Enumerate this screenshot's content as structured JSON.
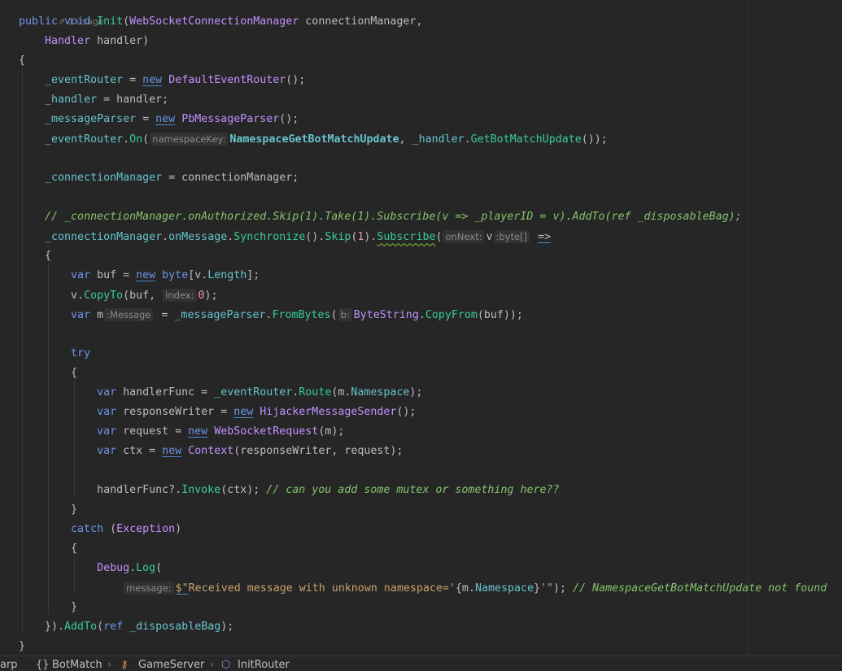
{
  "editor": {
    "usage_hint": "1 usage",
    "lines": [
      [
        [
          "kw",
          "public"
        ],
        [
          "txt",
          " "
        ],
        [
          "kw",
          "void"
        ],
        [
          "txt",
          " "
        ],
        [
          "fn",
          "Init"
        ],
        [
          "txt",
          "("
        ],
        [
          "type",
          "WebSocketConnectionManager"
        ],
        [
          "txt",
          " connectionManager,"
        ]
      ],
      [
        [
          "txt",
          "    "
        ],
        [
          "type",
          "Handler"
        ],
        [
          "txt",
          " handler)"
        ]
      ],
      [
        [
          "txt",
          "{"
        ]
      ],
      [
        [
          "txt",
          "    "
        ],
        [
          "field",
          "_eventRouter"
        ],
        [
          "txt",
          " = "
        ],
        [
          "kwu",
          "new"
        ],
        [
          "txt",
          " "
        ],
        [
          "type",
          "DefaultEventRouter"
        ],
        [
          "txt",
          "();"
        ]
      ],
      [
        [
          "txt",
          "    "
        ],
        [
          "field",
          "_handler"
        ],
        [
          "txt",
          " = handler;"
        ]
      ],
      [
        [
          "txt",
          "    "
        ],
        [
          "field",
          "_messageParser"
        ],
        [
          "txt",
          " = "
        ],
        [
          "kwu",
          "new"
        ],
        [
          "txt",
          " "
        ],
        [
          "type",
          "PbMessageParser"
        ],
        [
          "txt",
          "();"
        ]
      ],
      [
        [
          "txt",
          "    "
        ],
        [
          "field",
          "_eventRouter"
        ],
        [
          "txt",
          "."
        ],
        [
          "fn",
          "On"
        ],
        [
          "txt",
          "("
        ],
        [
          "hint",
          "namespaceKey:"
        ],
        [
          "const",
          "NamespaceGetBotMatchUpdate"
        ],
        [
          "txt",
          ", "
        ],
        [
          "field",
          "_handler"
        ],
        [
          "txt",
          "."
        ],
        [
          "fn",
          "GetBotMatchUpdate"
        ],
        [
          "txt",
          "());"
        ]
      ],
      [],
      [
        [
          "txt",
          "    "
        ],
        [
          "field",
          "_connectionManager"
        ],
        [
          "txt",
          " = connectionManager;"
        ]
      ],
      [],
      [
        [
          "txt",
          "    "
        ],
        [
          "cmt",
          "// _connectionManager.onAuthorized.Skip(1).Take(1).Subscribe(v => _playerID = v).AddTo(ref _disposableBag);"
        ]
      ],
      [
        [
          "txt",
          "    "
        ],
        [
          "field",
          "_connectionManager"
        ],
        [
          "txt",
          "."
        ],
        [
          "field",
          "onMessage"
        ],
        [
          "txt",
          "."
        ],
        [
          "fn",
          "Synchronize"
        ],
        [
          "txt",
          "()."
        ],
        [
          "fn",
          "Skip"
        ],
        [
          "txt",
          "("
        ],
        [
          "num",
          "1"
        ],
        [
          "txt",
          ")."
        ],
        [
          "fnw",
          "Subscribe"
        ],
        [
          "txt",
          "("
        ],
        [
          "hint",
          "onNext:"
        ],
        [
          "txt",
          "v"
        ],
        [
          "hint",
          ":byte[]"
        ],
        [
          "txt",
          " "
        ],
        [
          "txtu",
          "=>"
        ]
      ],
      [
        [
          "txt",
          "    {"
        ]
      ],
      [
        [
          "txt",
          "        "
        ],
        [
          "kw",
          "var"
        ],
        [
          "txt",
          " buf = "
        ],
        [
          "kwu",
          "new"
        ],
        [
          "txt",
          " "
        ],
        [
          "kw",
          "byte"
        ],
        [
          "txt",
          "[v."
        ],
        [
          "field",
          "Length"
        ],
        [
          "txt",
          "];"
        ]
      ],
      [
        [
          "txt",
          "        v."
        ],
        [
          "fn",
          "CopyTo"
        ],
        [
          "txt",
          "(buf, "
        ],
        [
          "hint",
          "index:"
        ],
        [
          "num",
          "0"
        ],
        [
          "txt",
          ");"
        ]
      ],
      [
        [
          "txt",
          "        "
        ],
        [
          "kw",
          "var"
        ],
        [
          "txt",
          " m"
        ],
        [
          "hint",
          ":Message"
        ],
        [
          "txt",
          " = "
        ],
        [
          "field",
          "_messageParser"
        ],
        [
          "txt",
          "."
        ],
        [
          "fn",
          "FromBytes"
        ],
        [
          "txt",
          "("
        ],
        [
          "hint",
          "b:"
        ],
        [
          "type",
          "ByteString"
        ],
        [
          "txt",
          "."
        ],
        [
          "fn",
          "CopyFrom"
        ],
        [
          "txt",
          "(buf));"
        ]
      ],
      [],
      [
        [
          "txt",
          "        "
        ],
        [
          "kw",
          "try"
        ]
      ],
      [
        [
          "txt",
          "        {"
        ]
      ],
      [
        [
          "txt",
          "            "
        ],
        [
          "kw",
          "var"
        ],
        [
          "txt",
          " handlerFunc = "
        ],
        [
          "field",
          "_eventRouter"
        ],
        [
          "txt",
          "."
        ],
        [
          "fn",
          "Route"
        ],
        [
          "txt",
          "(m."
        ],
        [
          "field",
          "Namespace"
        ],
        [
          "txt",
          ");"
        ]
      ],
      [
        [
          "txt",
          "            "
        ],
        [
          "kw",
          "var"
        ],
        [
          "txt",
          " responseWriter = "
        ],
        [
          "kwu",
          "new"
        ],
        [
          "txt",
          " "
        ],
        [
          "type",
          "HijackerMessageSender"
        ],
        [
          "txt",
          "();"
        ]
      ],
      [
        [
          "txt",
          "            "
        ],
        [
          "kw",
          "var"
        ],
        [
          "txt",
          " request = "
        ],
        [
          "kwu",
          "new"
        ],
        [
          "txt",
          " "
        ],
        [
          "type",
          "WebSocketRequest"
        ],
        [
          "txt",
          "(m);"
        ]
      ],
      [
        [
          "txt",
          "            "
        ],
        [
          "kw",
          "var"
        ],
        [
          "txt",
          " ctx = "
        ],
        [
          "kwu",
          "new"
        ],
        [
          "txt",
          " "
        ],
        [
          "type",
          "Context"
        ],
        [
          "txt",
          "(responseWriter, request);"
        ]
      ],
      [],
      [
        [
          "txt",
          "            handlerFunc?."
        ],
        [
          "fn",
          "Invoke"
        ],
        [
          "txt",
          "(ctx); "
        ],
        [
          "cmt",
          "// can you add some mutex or something here??"
        ]
      ],
      [
        [
          "txt",
          "        }"
        ]
      ],
      [
        [
          "txt",
          "        "
        ],
        [
          "kw",
          "catch"
        ],
        [
          "txt",
          " ("
        ],
        [
          "type",
          "Exception"
        ],
        [
          "txt",
          ")"
        ]
      ],
      [
        [
          "txt",
          "        {"
        ]
      ],
      [
        [
          "txt",
          "            "
        ],
        [
          "type",
          "Debug"
        ],
        [
          "txt",
          "."
        ],
        [
          "fn",
          "Log"
        ],
        [
          "txt",
          "("
        ]
      ],
      [
        [
          "txt",
          "                "
        ],
        [
          "hint",
          "message:"
        ],
        [
          "stru",
          "$\""
        ],
        [
          "str",
          "Received message with unknown namespace='"
        ],
        [
          "txt",
          "{m."
        ],
        [
          "field",
          "Namespace"
        ],
        [
          "txt",
          "}"
        ],
        [
          "str",
          "'\""
        ],
        [
          "txt",
          "); "
        ],
        [
          "cmt",
          "// NamespaceGetBotMatchUpdate not found"
        ]
      ],
      [
        [
          "txt",
          "        }"
        ]
      ],
      [
        [
          "txt",
          "    })."
        ],
        [
          "fn",
          "AddTo"
        ],
        [
          "txt",
          "("
        ],
        [
          "kw",
          "ref"
        ],
        [
          "txt",
          " "
        ],
        [
          "field",
          "_disposableBag"
        ],
        [
          "txt",
          ");"
        ]
      ],
      [
        [
          "txt",
          "}"
        ]
      ]
    ]
  },
  "breadcrumb": {
    "items": [
      "arp",
      "BotMatch",
      "GameServer",
      "InitRouter"
    ],
    "separator": "›"
  },
  "colors": {
    "background": "#262626",
    "keyword": "#6c95eb",
    "method": "#39cc9b",
    "type": "#c191ff",
    "field": "#66c3cc",
    "string": "#c9a26d",
    "comment": "#85c46c",
    "number": "#ed94c0"
  }
}
